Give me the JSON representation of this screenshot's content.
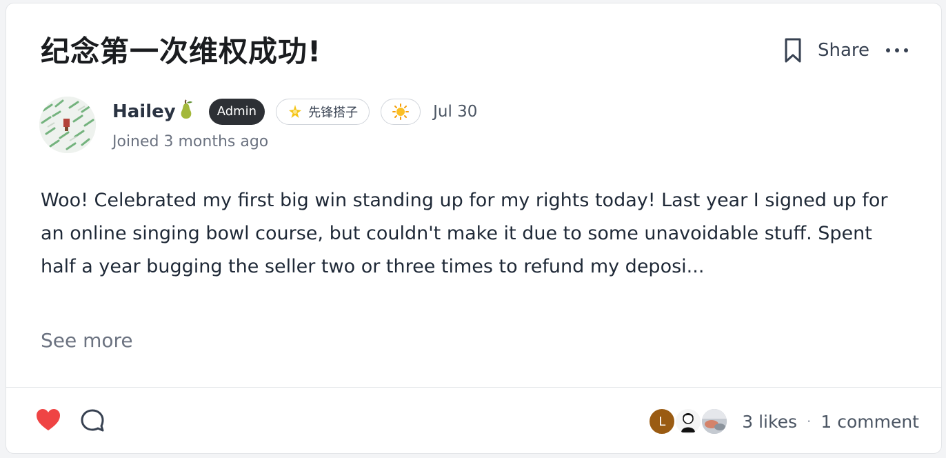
{
  "post": {
    "title": "纪念第一次维权成功!",
    "body": "Woo! Celebrated my first big win standing up for my rights today! Last year I signed up for an online singing bowl course, but couldn't make it due to some unavoidable stuff. Spent half a year bugging the seller two or three times to refund my deposi...",
    "see_more": "See more",
    "date": "Jul 30"
  },
  "header": {
    "share_label": "Share",
    "bookmark_icon": "bookmark-icon",
    "more_icon": "more-horizontal-icon"
  },
  "author": {
    "name": "Hailey",
    "name_emoji": "pear-icon",
    "joined": "Joined 3 months ago",
    "badges": {
      "admin": "Admin",
      "pioneer": "先锋搭子",
      "pioneer_icon": "sparkle-star-icon",
      "sun_icon": "sun-icon"
    }
  },
  "footer": {
    "like_icon": "heart-icon",
    "comment_icon": "comment-bubble-icon",
    "liker_initial": "L",
    "likes": "3 likes",
    "separator": "·",
    "comments": "1 comment",
    "colors": {
      "heart": "#ef4444",
      "liker_l": "#9a5b12",
      "admin_badge": "#2d3035"
    }
  }
}
